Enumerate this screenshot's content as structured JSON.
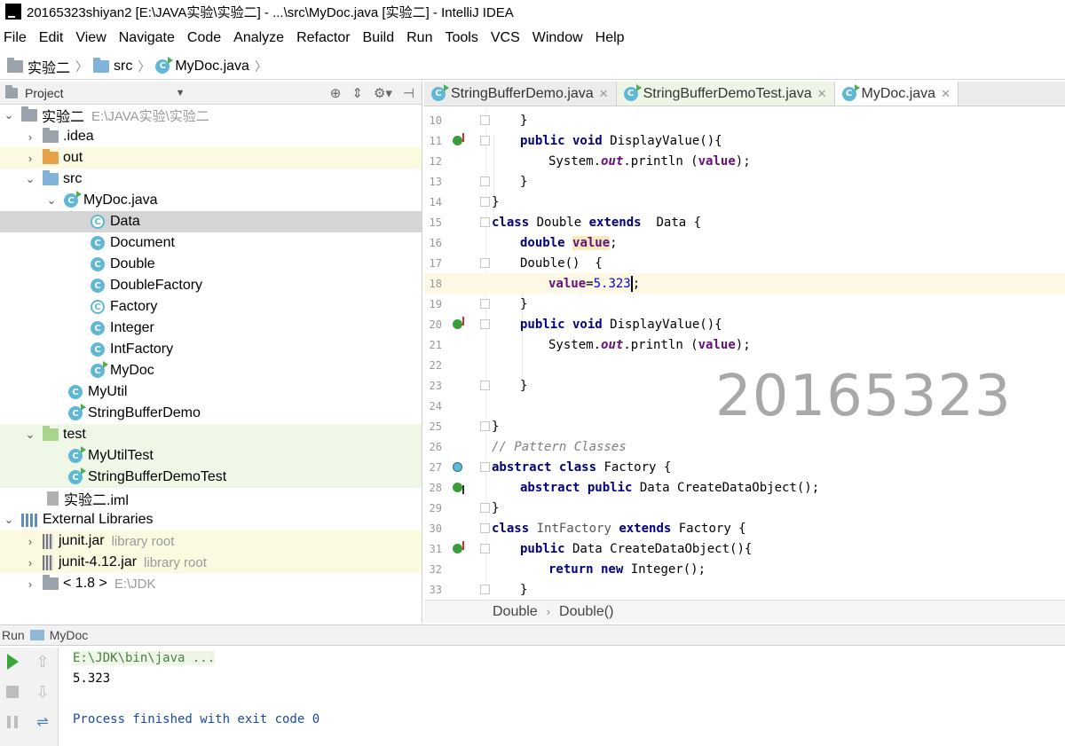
{
  "window": {
    "title": "20165323shiyan2 [E:\\JAVA实验\\实验二] - ...\\src\\MyDoc.java [实验二] - IntelliJ IDEA"
  },
  "menu": [
    "File",
    "Edit",
    "View",
    "Navigate",
    "Code",
    "Analyze",
    "Refactor",
    "Build",
    "Run",
    "Tools",
    "VCS",
    "Window",
    "Help"
  ],
  "navbar": {
    "crumbs": [
      "实验二",
      "src",
      "MyDoc.java"
    ]
  },
  "project": {
    "header": "Project",
    "tree": [
      {
        "label": "实验二",
        "extra": "E:\\JAVA实验\\实验二"
      },
      {
        "label": ".idea"
      },
      {
        "label": "out"
      },
      {
        "label": "src"
      },
      {
        "label": "MyDoc.java"
      },
      {
        "label": "Data"
      },
      {
        "label": "Document"
      },
      {
        "label": "Double"
      },
      {
        "label": "DoubleFactory"
      },
      {
        "label": "Factory"
      },
      {
        "label": "Integer"
      },
      {
        "label": "IntFactory"
      },
      {
        "label": "MyDoc"
      },
      {
        "label": "MyUtil"
      },
      {
        "label": "StringBufferDemo"
      },
      {
        "label": "test"
      },
      {
        "label": "MyUtilTest"
      },
      {
        "label": "StringBufferDemoTest"
      },
      {
        "label": "实验二.iml"
      },
      {
        "label": "External Libraries"
      },
      {
        "label": "junit.jar",
        "extra": "library root"
      },
      {
        "label": "junit-4.12.jar",
        "extra": "library root"
      },
      {
        "label": "< 1.8 >",
        "extra": "E:\\JDK"
      }
    ]
  },
  "tabs": [
    {
      "label": "StringBufferDemo.java"
    },
    {
      "label": "StringBufferDemoTest.java"
    },
    {
      "label": "MyDoc.java"
    }
  ],
  "editor": {
    "line_numbers": [
      "10",
      "11",
      "12",
      "13",
      "14",
      "15",
      "16",
      "17",
      "18",
      "19",
      "20",
      "21",
      "22",
      "23",
      "24",
      "25",
      "26",
      "27",
      "28",
      "29",
      "30",
      "31",
      "32",
      "33"
    ],
    "watermark": "20165323",
    "breadcrumb": [
      "Double",
      "Double()"
    ],
    "lines": {
      "l10": "}",
      "l11_a": "public void",
      "l11_b": " DisplayValue(){",
      "l12_a": "System.",
      "l12_b": "out",
      "l12_c": ".println (",
      "l12_d": "value",
      "l12_e": ");",
      "l13": "}",
      "l14": "}",
      "l15_a": "class",
      "l15_b": " Double ",
      "l15_c": "extends",
      "l15_d": "  Data {",
      "l16_a": "double",
      "l16_b": "value",
      "l16_c": ";",
      "l17": "Double()  {",
      "l18_a": "value",
      "l18_b": "=",
      "l18_c": "5.323",
      "l18_d": ";",
      "l19": "}",
      "l20_a": "public void",
      "l20_b": " DisplayValue(){",
      "l21_a": "System.",
      "l21_b": "out",
      "l21_c": ".println (",
      "l21_d": "value",
      "l21_e": ");",
      "l23": "}",
      "l25": "}",
      "l26": "// Pattern Classes",
      "l27_a": "abstract class",
      "l27_b": " Factory {",
      "l28_a": "abstract public",
      "l28_b": " Data CreateDataObject();",
      "l29": "}",
      "l30_a": "class",
      "l30_b": " IntFactory ",
      "l30_c": "extends",
      "l30_d": " Factory {",
      "l31_a": "public",
      "l31_b": " Data CreateDataObject(){",
      "l32_a": "return new",
      "l32_b": " Integer();",
      "l33": "}"
    }
  },
  "run": {
    "label": "Run",
    "config": "MyDoc",
    "console": [
      "E:\\JDK\\bin\\java ...",
      "5.323",
      "Process finished with exit code 0"
    ]
  },
  "colors": {
    "keyword": "#000080",
    "field": "#660e7a",
    "number": "#0000ff",
    "comment": "#808080",
    "selection": "#d5d5d5"
  }
}
